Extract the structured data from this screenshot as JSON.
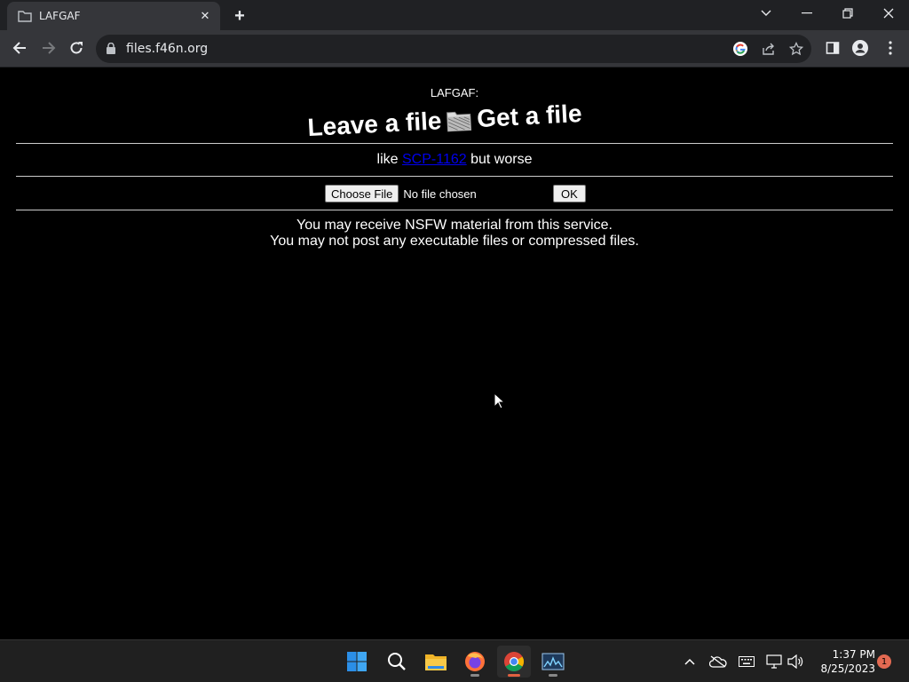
{
  "browser": {
    "tab_title": "LAFGAF",
    "url": "files.f46n.org"
  },
  "page": {
    "site_name": "LAFGAF:",
    "banner_left": "Leave a file",
    "banner_right": "Get a file",
    "tagline_prefix": "like",
    "tagline_link": "SCP-1162",
    "tagline_suffix": "but worse",
    "choose_file_label": "Choose File",
    "no_file_label": "No file chosen",
    "ok_label": "OK",
    "notice_line1": "You may receive NSFW material from this service.",
    "notice_line2": "You may not post any executable files or compressed files.",
    "link_color": "#0000ee",
    "background_color": "#000000"
  },
  "taskbar": {
    "apps": [
      "start-icon",
      "search-icon",
      "file-explorer-icon",
      "firefox-icon",
      "chrome-icon",
      "resource-monitor-icon"
    ],
    "time": "1:37 PM",
    "date": "8/25/2023",
    "notification_count": "1"
  }
}
